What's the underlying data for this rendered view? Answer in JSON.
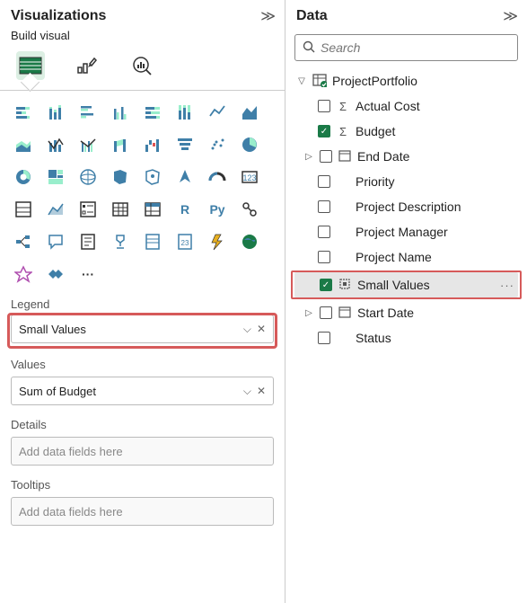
{
  "viz": {
    "title": "Visualizations",
    "subtitle": "Build visual",
    "tabs": [
      "build-visual",
      "format-visual",
      "analytics"
    ],
    "legend": {
      "label": "Legend",
      "field": "Small Values"
    },
    "values": {
      "label": "Values",
      "field": "Sum of Budget"
    },
    "details": {
      "label": "Details",
      "placeholder": "Add data fields here"
    },
    "tooltips": {
      "label": "Tooltips",
      "placeholder": "Add data fields here"
    },
    "gallery_more": "···",
    "r_label": "R",
    "py_label": "Py"
  },
  "data": {
    "title": "Data",
    "search_placeholder": "Search",
    "table": "ProjectPortfolio",
    "fields": [
      {
        "name": "Actual Cost",
        "checked": false,
        "icon": "sigma",
        "expandable": false
      },
      {
        "name": "Budget",
        "checked": true,
        "icon": "sigma",
        "expandable": false
      },
      {
        "name": "End Date",
        "checked": false,
        "icon": "date",
        "expandable": true
      },
      {
        "name": "Priority",
        "checked": false,
        "icon": "",
        "expandable": false
      },
      {
        "name": "Project Description",
        "checked": false,
        "icon": "",
        "expandable": false
      },
      {
        "name": "Project Manager",
        "checked": false,
        "icon": "",
        "expandable": false
      },
      {
        "name": "Project Name",
        "checked": false,
        "icon": "",
        "expandable": false
      },
      {
        "name": "Small Values",
        "checked": true,
        "icon": "group",
        "expandable": false,
        "selected": true,
        "highlighted": true
      },
      {
        "name": "Start Date",
        "checked": false,
        "icon": "date",
        "expandable": true
      },
      {
        "name": "Status",
        "checked": false,
        "icon": "",
        "expandable": false
      }
    ],
    "row_more": "···"
  }
}
